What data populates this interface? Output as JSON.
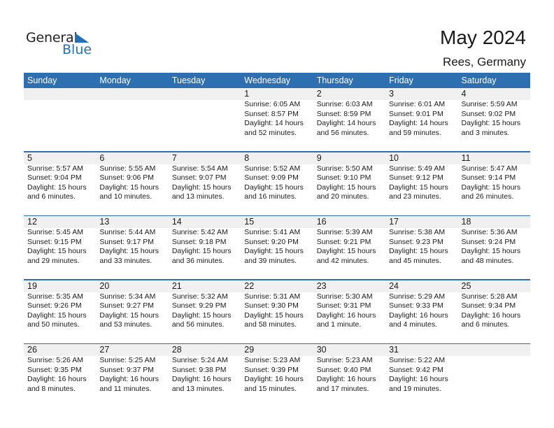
{
  "logo": {
    "part1": "General",
    "part2": "Blue",
    "accent_color": "#2470b8"
  },
  "header": {
    "title": "May 2024",
    "location": "Rees, Germany"
  },
  "colors": {
    "header_bg": "#2d6fb1",
    "band_bg": "#f0f0f0"
  },
  "weekdays": [
    "Sunday",
    "Monday",
    "Tuesday",
    "Wednesday",
    "Thursday",
    "Friday",
    "Saturday"
  ],
  "weeks": [
    [
      null,
      null,
      null,
      {
        "day": "1",
        "sunrise": "Sunrise: 6:05 AM",
        "sunset": "Sunset: 8:57 PM",
        "daylight1": "Daylight: 14 hours",
        "daylight2": "and 52 minutes."
      },
      {
        "day": "2",
        "sunrise": "Sunrise: 6:03 AM",
        "sunset": "Sunset: 8:59 PM",
        "daylight1": "Daylight: 14 hours",
        "daylight2": "and 56 minutes."
      },
      {
        "day": "3",
        "sunrise": "Sunrise: 6:01 AM",
        "sunset": "Sunset: 9:01 PM",
        "daylight1": "Daylight: 14 hours",
        "daylight2": "and 59 minutes."
      },
      {
        "day": "4",
        "sunrise": "Sunrise: 5:59 AM",
        "sunset": "Sunset: 9:02 PM",
        "daylight1": "Daylight: 15 hours",
        "daylight2": "and 3 minutes."
      }
    ],
    [
      {
        "day": "5",
        "sunrise": "Sunrise: 5:57 AM",
        "sunset": "Sunset: 9:04 PM",
        "daylight1": "Daylight: 15 hours",
        "daylight2": "and 6 minutes."
      },
      {
        "day": "6",
        "sunrise": "Sunrise: 5:55 AM",
        "sunset": "Sunset: 9:06 PM",
        "daylight1": "Daylight: 15 hours",
        "daylight2": "and 10 minutes."
      },
      {
        "day": "7",
        "sunrise": "Sunrise: 5:54 AM",
        "sunset": "Sunset: 9:07 PM",
        "daylight1": "Daylight: 15 hours",
        "daylight2": "and 13 minutes."
      },
      {
        "day": "8",
        "sunrise": "Sunrise: 5:52 AM",
        "sunset": "Sunset: 9:09 PM",
        "daylight1": "Daylight: 15 hours",
        "daylight2": "and 16 minutes."
      },
      {
        "day": "9",
        "sunrise": "Sunrise: 5:50 AM",
        "sunset": "Sunset: 9:10 PM",
        "daylight1": "Daylight: 15 hours",
        "daylight2": "and 20 minutes."
      },
      {
        "day": "10",
        "sunrise": "Sunrise: 5:49 AM",
        "sunset": "Sunset: 9:12 PM",
        "daylight1": "Daylight: 15 hours",
        "daylight2": "and 23 minutes."
      },
      {
        "day": "11",
        "sunrise": "Sunrise: 5:47 AM",
        "sunset": "Sunset: 9:14 PM",
        "daylight1": "Daylight: 15 hours",
        "daylight2": "and 26 minutes."
      }
    ],
    [
      {
        "day": "12",
        "sunrise": "Sunrise: 5:45 AM",
        "sunset": "Sunset: 9:15 PM",
        "daylight1": "Daylight: 15 hours",
        "daylight2": "and 29 minutes."
      },
      {
        "day": "13",
        "sunrise": "Sunrise: 5:44 AM",
        "sunset": "Sunset: 9:17 PM",
        "daylight1": "Daylight: 15 hours",
        "daylight2": "and 33 minutes."
      },
      {
        "day": "14",
        "sunrise": "Sunrise: 5:42 AM",
        "sunset": "Sunset: 9:18 PM",
        "daylight1": "Daylight: 15 hours",
        "daylight2": "and 36 minutes."
      },
      {
        "day": "15",
        "sunrise": "Sunrise: 5:41 AM",
        "sunset": "Sunset: 9:20 PM",
        "daylight1": "Daylight: 15 hours",
        "daylight2": "and 39 minutes."
      },
      {
        "day": "16",
        "sunrise": "Sunrise: 5:39 AM",
        "sunset": "Sunset: 9:21 PM",
        "daylight1": "Daylight: 15 hours",
        "daylight2": "and 42 minutes."
      },
      {
        "day": "17",
        "sunrise": "Sunrise: 5:38 AM",
        "sunset": "Sunset: 9:23 PM",
        "daylight1": "Daylight: 15 hours",
        "daylight2": "and 45 minutes."
      },
      {
        "day": "18",
        "sunrise": "Sunrise: 5:36 AM",
        "sunset": "Sunset: 9:24 PM",
        "daylight1": "Daylight: 15 hours",
        "daylight2": "and 48 minutes."
      }
    ],
    [
      {
        "day": "19",
        "sunrise": "Sunrise: 5:35 AM",
        "sunset": "Sunset: 9:26 PM",
        "daylight1": "Daylight: 15 hours",
        "daylight2": "and 50 minutes."
      },
      {
        "day": "20",
        "sunrise": "Sunrise: 5:34 AM",
        "sunset": "Sunset: 9:27 PM",
        "daylight1": "Daylight: 15 hours",
        "daylight2": "and 53 minutes."
      },
      {
        "day": "21",
        "sunrise": "Sunrise: 5:32 AM",
        "sunset": "Sunset: 9:29 PM",
        "daylight1": "Daylight: 15 hours",
        "daylight2": "and 56 minutes."
      },
      {
        "day": "22",
        "sunrise": "Sunrise: 5:31 AM",
        "sunset": "Sunset: 9:30 PM",
        "daylight1": "Daylight: 15 hours",
        "daylight2": "and 58 minutes."
      },
      {
        "day": "23",
        "sunrise": "Sunrise: 5:30 AM",
        "sunset": "Sunset: 9:31 PM",
        "daylight1": "Daylight: 16 hours",
        "daylight2": "and 1 minute."
      },
      {
        "day": "24",
        "sunrise": "Sunrise: 5:29 AM",
        "sunset": "Sunset: 9:33 PM",
        "daylight1": "Daylight: 16 hours",
        "daylight2": "and 4 minutes."
      },
      {
        "day": "25",
        "sunrise": "Sunrise: 5:28 AM",
        "sunset": "Sunset: 9:34 PM",
        "daylight1": "Daylight: 16 hours",
        "daylight2": "and 6 minutes."
      }
    ],
    [
      {
        "day": "26",
        "sunrise": "Sunrise: 5:26 AM",
        "sunset": "Sunset: 9:35 PM",
        "daylight1": "Daylight: 16 hours",
        "daylight2": "and 8 minutes."
      },
      {
        "day": "27",
        "sunrise": "Sunrise: 5:25 AM",
        "sunset": "Sunset: 9:37 PM",
        "daylight1": "Daylight: 16 hours",
        "daylight2": "and 11 minutes."
      },
      {
        "day": "28",
        "sunrise": "Sunrise: 5:24 AM",
        "sunset": "Sunset: 9:38 PM",
        "daylight1": "Daylight: 16 hours",
        "daylight2": "and 13 minutes."
      },
      {
        "day": "29",
        "sunrise": "Sunrise: 5:23 AM",
        "sunset": "Sunset: 9:39 PM",
        "daylight1": "Daylight: 16 hours",
        "daylight2": "and 15 minutes."
      },
      {
        "day": "30",
        "sunrise": "Sunrise: 5:23 AM",
        "sunset": "Sunset: 9:40 PM",
        "daylight1": "Daylight: 16 hours",
        "daylight2": "and 17 minutes."
      },
      {
        "day": "31",
        "sunrise": "Sunrise: 5:22 AM",
        "sunset": "Sunset: 9:42 PM",
        "daylight1": "Daylight: 16 hours",
        "daylight2": "and 19 minutes."
      },
      null
    ]
  ]
}
